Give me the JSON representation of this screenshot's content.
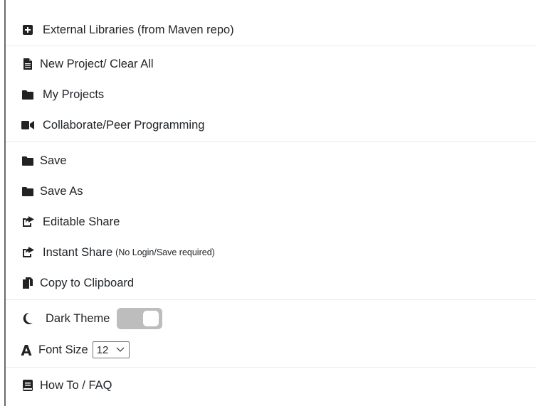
{
  "menu": {
    "items": [
      {
        "id": "external-libraries",
        "label": "External Libraries (from Maven repo)",
        "icon": "plus-square-icon"
      },
      {
        "id": "new-project",
        "label": "New Project/ Clear All",
        "icon": "file-icon"
      },
      {
        "id": "my-projects",
        "label": "My Projects",
        "icon": "folder-icon"
      },
      {
        "id": "collaborate",
        "label": "Collaborate/Peer Programming",
        "icon": "video-camera-icon"
      },
      {
        "id": "save",
        "label": "Save",
        "icon": "folder-icon"
      },
      {
        "id": "save-as",
        "label": "Save As",
        "icon": "folder-icon"
      },
      {
        "id": "editable-share",
        "label": "Editable Share",
        "icon": "share-square-icon"
      },
      {
        "id": "instant-share",
        "label": "Instant Share",
        "sublabel": "(No Login/Save required)",
        "icon": "share-square-icon"
      },
      {
        "id": "copy-clipboard",
        "label": "Copy to Clipboard",
        "icon": "copy-icon"
      }
    ],
    "dark_theme": {
      "label": "Dark Theme",
      "icon": "moon-icon",
      "enabled": false
    },
    "font_size": {
      "label": "Font Size",
      "icon": "font-icon",
      "value": "12"
    },
    "howto": {
      "label": "How To / FAQ",
      "icon": "book-icon"
    }
  }
}
